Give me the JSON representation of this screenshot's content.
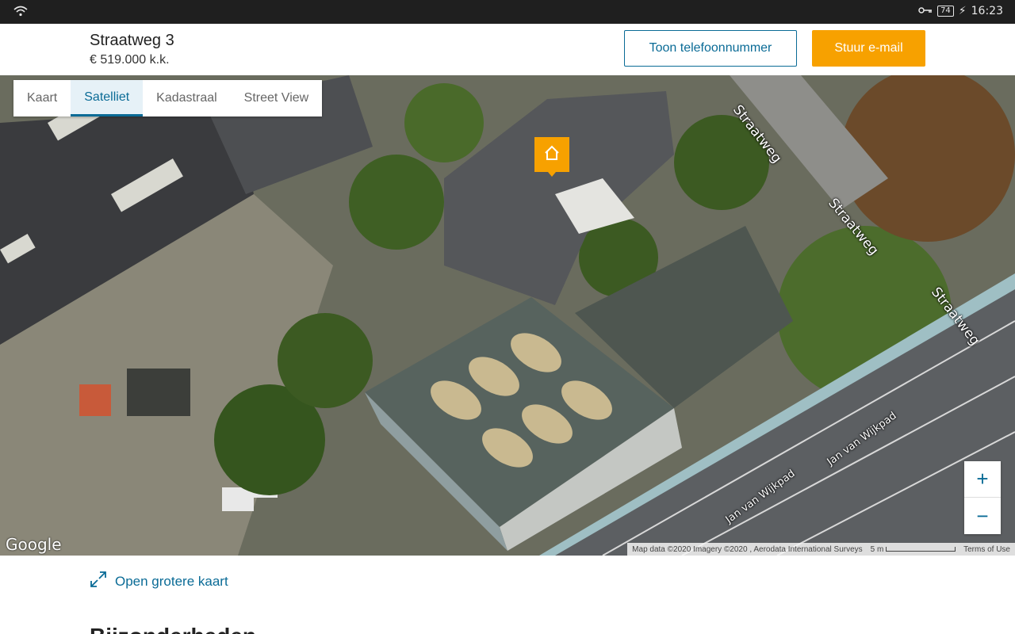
{
  "status_bar": {
    "time": "16:23",
    "battery": "74"
  },
  "listing": {
    "title": "Straatweg 3",
    "price": "€ 519.000 k.k."
  },
  "actions": {
    "phone_button": "Toon telefoonnummer",
    "email_button": "Stuur e-mail"
  },
  "map": {
    "tabs": [
      {
        "label": "Kaart",
        "active": false
      },
      {
        "label": "Satelliet",
        "active": true
      },
      {
        "label": "Kadastraal",
        "active": false
      },
      {
        "label": "Street View",
        "active": false
      }
    ],
    "road_labels": [
      "Straatweg",
      "Straatweg",
      "Straatweg",
      "Jan van Wijkpad",
      "Jan van Wijkpad"
    ],
    "logo": "Google",
    "attribution": "Map data ©2020 Imagery ©2020 , Aerodata International Surveys",
    "scale": "5 m",
    "terms": "Terms of Use",
    "zoom_in": "+",
    "zoom_out": "−"
  },
  "open_larger_map": "Open grotere kaart",
  "next_section": "Bijzonderheden"
}
